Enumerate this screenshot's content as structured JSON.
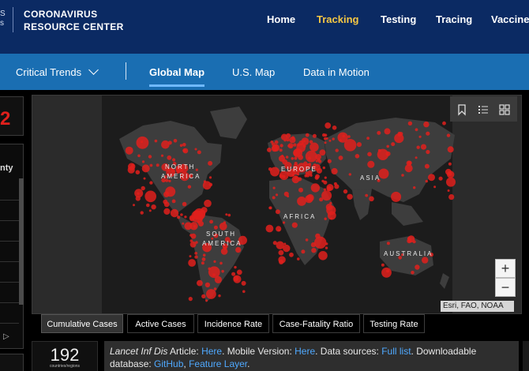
{
  "header": {
    "logo_stub": [
      "S",
      "s"
    ],
    "brand_line1": "CORONAVIRUS",
    "brand_line2": "RESOURCE CENTER",
    "nav": [
      {
        "label": "Home",
        "active": false
      },
      {
        "label": "Tracking",
        "active": true
      },
      {
        "label": "Testing",
        "active": false
      },
      {
        "label": "Tracing",
        "active": false
      },
      {
        "label": "Vaccine",
        "active": false
      }
    ],
    "active_color": "#f6c843"
  },
  "subnav": {
    "items": [
      {
        "label": "Critical Trends",
        "active": false,
        "has_dropdown": true
      },
      {
        "label": "Global Map",
        "active": true
      },
      {
        "label": "U.S. Map",
        "active": false
      },
      {
        "label": "Data in Motion",
        "active": false
      }
    ]
  },
  "left_panel": {
    "partial_number": "2",
    "partial_column_header": "nty",
    "scroll_arrow": "▷"
  },
  "map": {
    "continents": [
      "NORTH",
      "AMERICA",
      "EUROPE",
      "ASIA",
      "AFRICA",
      "SOUTH",
      "AMERICA",
      "AUSTRALIA"
    ],
    "zoom_in": "+",
    "zoom_out": "−",
    "attribution": "Esri, FAO, NOAA",
    "tool_icons": [
      "bookmark-icon",
      "legend-list-icon",
      "basemap-grid-icon"
    ],
    "marker_color": "#e0201c"
  },
  "tabs": [
    {
      "label": "Cumulative Cases",
      "active": true
    },
    {
      "label": "Active Cases",
      "active": false
    },
    {
      "label": "Incidence Rate",
      "active": false
    },
    {
      "label": "Case-Fatality Ratio",
      "active": false
    },
    {
      "label": "Testing Rate",
      "active": false
    }
  ],
  "footer": {
    "count": "192",
    "count_label": "countries/regions",
    "info": {
      "journal": "Lancet Inf Dis",
      "article_text": " Article: ",
      "here1": "Here",
      "mobile_text": ". Mobile Version: ",
      "here2": "Here",
      "sources_text": ". Data sources: ",
      "full_list": "Full list",
      "download_text": ". Downloadable database: ",
      "github": "GitHub",
      "comma": ", ",
      "feature_layer": "Feature Layer",
      "end": "."
    }
  }
}
